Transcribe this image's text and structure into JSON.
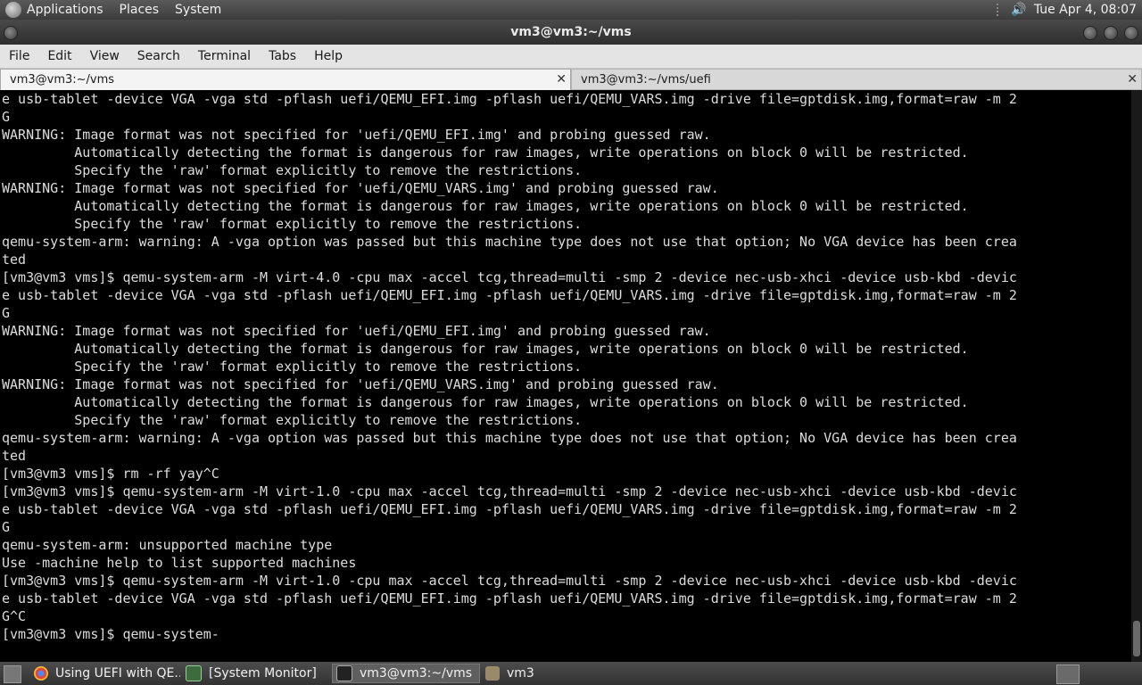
{
  "top_panel": {
    "menus": [
      "Applications",
      "Places",
      "System"
    ],
    "clock": "Tue Apr  4, 08:07"
  },
  "window": {
    "title": "vm3@vm3:~/vms"
  },
  "menubar": [
    "File",
    "Edit",
    "View",
    "Search",
    "Terminal",
    "Tabs",
    "Help"
  ],
  "tabs": [
    {
      "label": "vm3@vm3:~/vms",
      "active": true
    },
    {
      "label": "vm3@vm3:~/vms/uefi",
      "active": false
    }
  ],
  "terminal": {
    "lines": [
      "e usb-tablet -device VGA -vga std -pflash uefi/QEMU_EFI.img -pflash uefi/QEMU_VARS.img -drive file=gptdisk.img,format=raw -m 2",
      "G",
      "WARNING: Image format was not specified for 'uefi/QEMU_EFI.img' and probing guessed raw.",
      "         Automatically detecting the format is dangerous for raw images, write operations on block 0 will be restricted.",
      "         Specify the 'raw' format explicitly to remove the restrictions.",
      "WARNING: Image format was not specified for 'uefi/QEMU_VARS.img' and probing guessed raw.",
      "         Automatically detecting the format is dangerous for raw images, write operations on block 0 will be restricted.",
      "         Specify the 'raw' format explicitly to remove the restrictions.",
      "qemu-system-arm: warning: A -vga option was passed but this machine type does not use that option; No VGA device has been crea",
      "ted",
      "[vm3@vm3 vms]$ qemu-system-arm -M virt-4.0 -cpu max -accel tcg,thread=multi -smp 2 -device nec-usb-xhci -device usb-kbd -devic",
      "e usb-tablet -device VGA -vga std -pflash uefi/QEMU_EFI.img -pflash uefi/QEMU_VARS.img -drive file=gptdisk.img,format=raw -m 2",
      "G",
      "WARNING: Image format was not specified for 'uefi/QEMU_EFI.img' and probing guessed raw.",
      "         Automatically detecting the format is dangerous for raw images, write operations on block 0 will be restricted.",
      "         Specify the 'raw' format explicitly to remove the restrictions.",
      "WARNING: Image format was not specified for 'uefi/QEMU_VARS.img' and probing guessed raw.",
      "         Automatically detecting the format is dangerous for raw images, write operations on block 0 will be restricted.",
      "         Specify the 'raw' format explicitly to remove the restrictions.",
      "qemu-system-arm: warning: A -vga option was passed but this machine type does not use that option; No VGA device has been crea",
      "ted",
      "[vm3@vm3 vms]$ rm -rf yay^C",
      "[vm3@vm3 vms]$ qemu-system-arm -M virt-1.0 -cpu max -accel tcg,thread=multi -smp 2 -device nec-usb-xhci -device usb-kbd -devic",
      "e usb-tablet -device VGA -vga std -pflash uefi/QEMU_EFI.img -pflash uefi/QEMU_VARS.img -drive file=gptdisk.img,format=raw -m 2",
      "G",
      "qemu-system-arm: unsupported machine type",
      "Use -machine help to list supported machines",
      "[vm3@vm3 vms]$ qemu-system-arm -M virt-1.0 -cpu max -accel tcg,thread=multi -smp 2 -device nec-usb-xhci -device usb-kbd -devic",
      "e usb-tablet -device VGA -vga std -pflash uefi/QEMU_EFI.img -pflash uefi/QEMU_VARS.img -drive file=gptdisk.img,format=raw -m 2",
      "G^C",
      "[vm3@vm3 vms]$ qemu-system-"
    ]
  },
  "taskbar": {
    "tasks": [
      {
        "label": "Using UEFI with QE...",
        "icon": "chrome-icon",
        "active": false
      },
      {
        "label": "[System Monitor]",
        "icon": "system-monitor-icon",
        "active": false
      },
      {
        "label": "vm3@vm3:~/vms",
        "icon": "terminal-icon",
        "active": true
      },
      {
        "label": "vm3",
        "icon": "folder-icon",
        "active": false
      }
    ]
  },
  "colors": {
    "terminal_bg": "#000000",
    "terminal_fg": "#dcdcdc",
    "panel_bg": "#3c3c3c"
  }
}
